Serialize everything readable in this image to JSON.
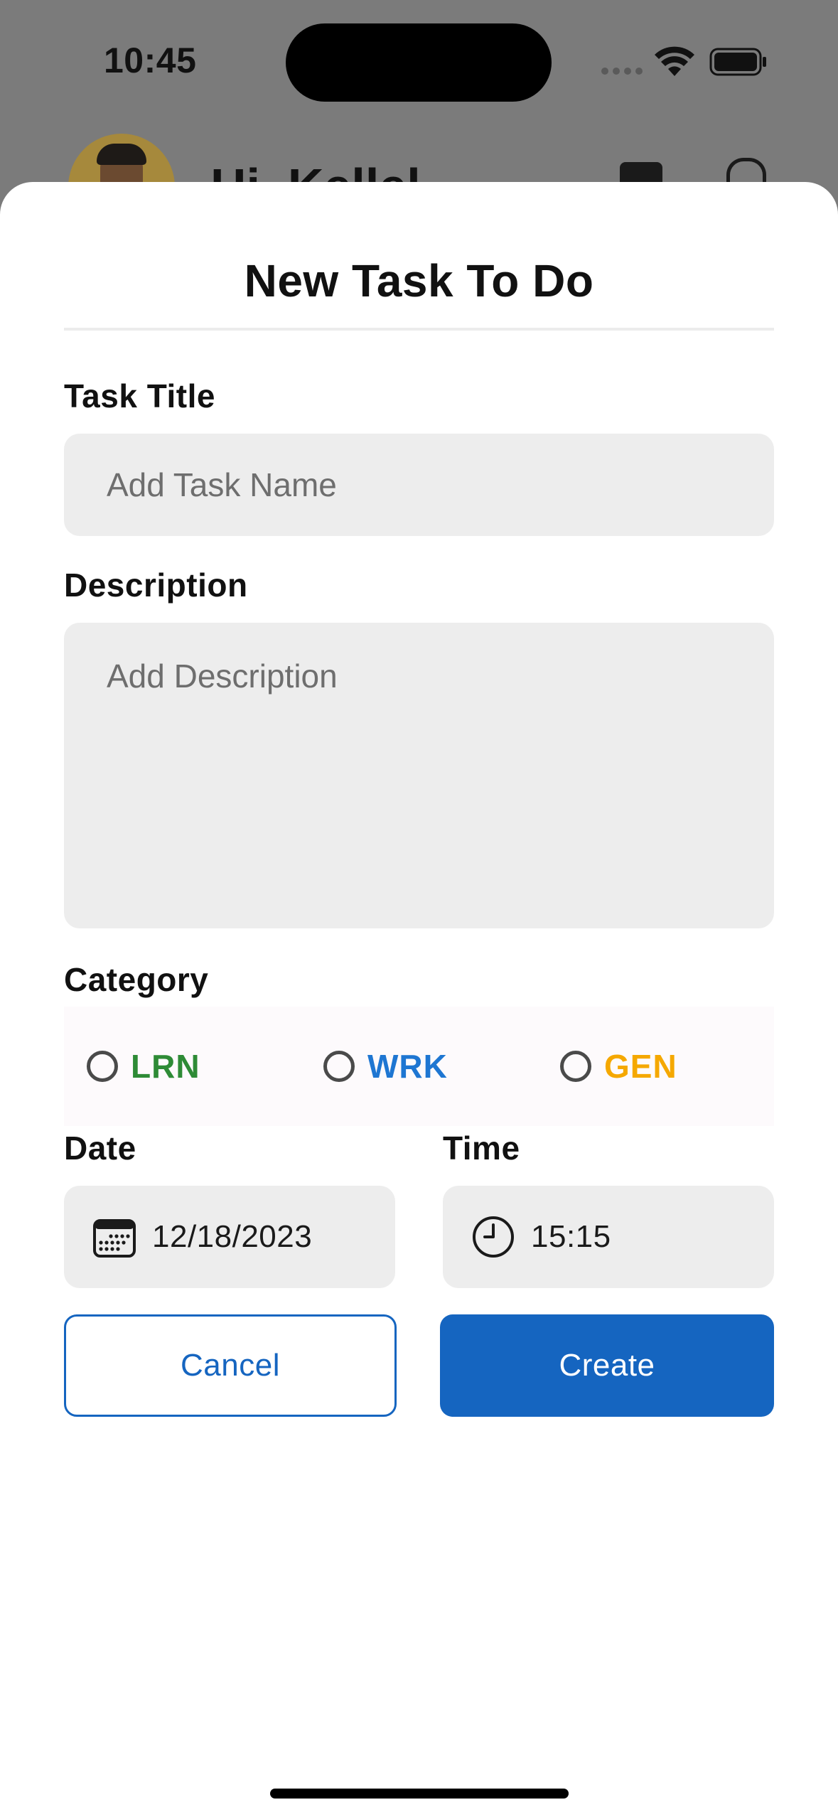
{
  "status_bar": {
    "time": "10:45"
  },
  "background_screen": {
    "greeting": "Hi, Kellel"
  },
  "sheet": {
    "title": "New Task To Do",
    "task_title": {
      "label": "Task Title",
      "placeholder": "Add Task Name",
      "value": ""
    },
    "description": {
      "label": "Description",
      "placeholder": "Add Description",
      "value": ""
    },
    "category": {
      "label": "Category",
      "options": [
        {
          "label": "LRN",
          "color": "#2e8b36",
          "selected": false
        },
        {
          "label": "WRK",
          "color": "#1e76d2",
          "selected": false
        },
        {
          "label": "GEN",
          "color": "#f5a800",
          "selected": false
        }
      ]
    },
    "date": {
      "label": "Date",
      "value": "12/18/2023",
      "icon": "calendar-icon"
    },
    "time": {
      "label": "Time",
      "value": "15:15",
      "icon": "clock-icon"
    },
    "buttons": {
      "cancel": "Cancel",
      "create": "Create"
    }
  },
  "colors": {
    "primary": "#1565c0",
    "input_bg": "#ededed",
    "scrim": "#7b7b7b"
  }
}
